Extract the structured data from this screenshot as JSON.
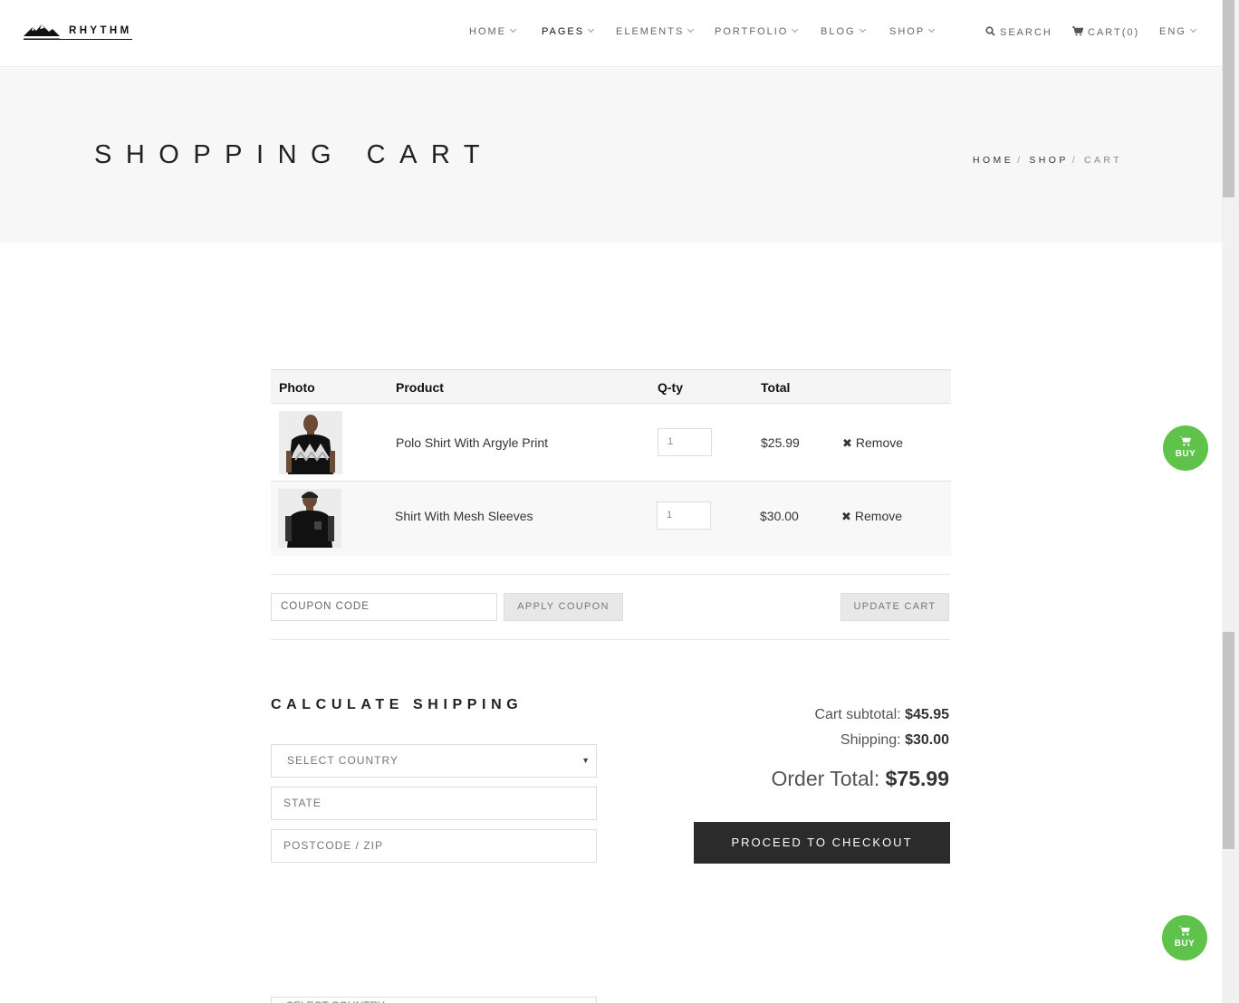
{
  "brand": {
    "name": "RHYTHM"
  },
  "nav": {
    "items": [
      {
        "label": "HOME",
        "active": false
      },
      {
        "label": "PAGES",
        "active": true
      },
      {
        "label": "ELEMENTS",
        "active": false
      },
      {
        "label": "PORTFOLIO",
        "active": false
      },
      {
        "label": "BLOG",
        "active": false
      },
      {
        "label": "SHOP",
        "active": false
      }
    ],
    "search": "SEARCH",
    "cart": "CART(0)",
    "lang": "ENG"
  },
  "page": {
    "title": "SHOPPING CART",
    "breadcrumb": [
      "HOME",
      "SHOP",
      "CART"
    ]
  },
  "cart": {
    "headers": {
      "photo": "Photo",
      "product": "Product",
      "qty": "Q-ty",
      "total": "Total"
    },
    "items": [
      {
        "name": "Polo Shirt With Argyle Print",
        "qty": "1",
        "total": "$25.99",
        "remove": "Remove"
      },
      {
        "name": "Shirt With Mesh Sleeves",
        "qty": "1",
        "total": "$30.00",
        "remove": "Remove"
      }
    ],
    "coupon_placeholder": "COUPON CODE",
    "apply_coupon": "APPLY COUPON",
    "update_cart": "UPDATE CART"
  },
  "shipping": {
    "title": "CALCULATE SHIPPING",
    "country": "SELECT COUNTRY",
    "state": "STATE",
    "postcode": "POSTCODE / ZIP"
  },
  "totals": {
    "subtotal_label": "Cart subtotal:",
    "subtotal": "$45.95",
    "shipping_label": "Shipping:",
    "shipping": "$30.00",
    "order_label": "Order Total:",
    "order": "$75.99",
    "checkout": "PROCEED TO CHECKOUT"
  },
  "buy_label": "BUY",
  "colors": {
    "accent_green": "#5fc24a",
    "dark_button": "#2b2b2b",
    "band_bg": "#f7f7f7"
  }
}
